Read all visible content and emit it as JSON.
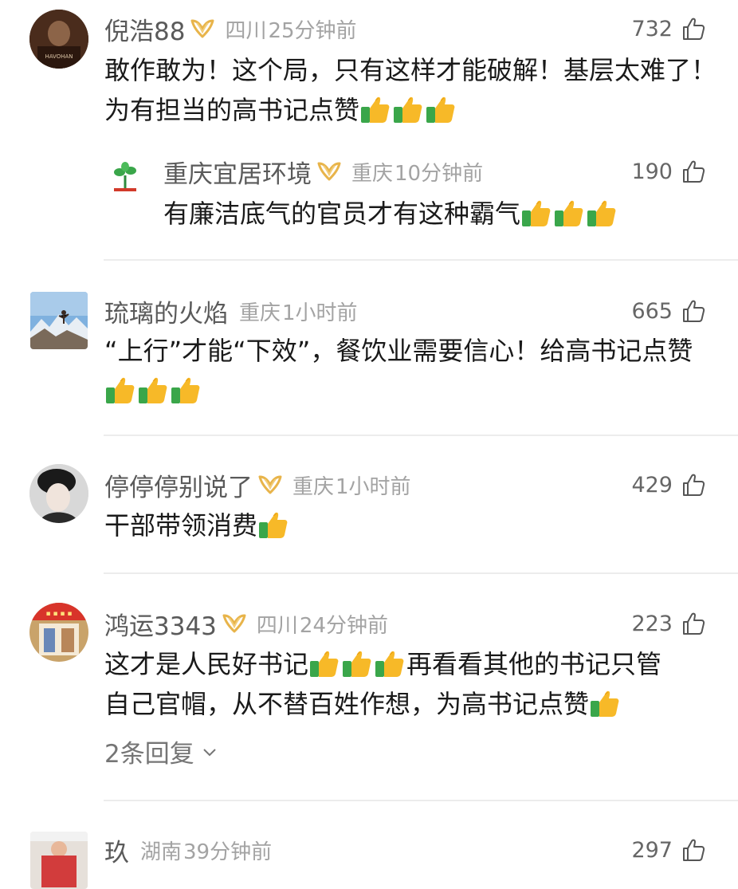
{
  "comments": [
    {
      "user": "倪浩88",
      "location": "四川",
      "time": "25分钟前",
      "likes": "732",
      "text": "敢作敢为！这个局，只有这样才能破解！基层太难了！为有担当的高书记点赞",
      "emoji_count": 3,
      "avatar_text": "HAVOHAN",
      "vip": true
    },
    {
      "user": "重庆宜居环境",
      "location": "重庆",
      "time": "10分钟前",
      "likes": "190",
      "text": "有廉洁底气的官员才有这种霸气",
      "emoji_count": 3,
      "vip": true
    },
    {
      "user": "琉璃的火焰",
      "location": "重庆",
      "time": "1小时前",
      "likes": "665",
      "text": "“上行”才能“下效”，餐饮业需要信心！给高书记点赞",
      "emoji_count": 3,
      "vip": false
    },
    {
      "user": "停停停别说了",
      "location": "重庆",
      "time": "1小时前",
      "likes": "429",
      "text": "干部带领消费",
      "emoji_count": 1,
      "vip": true
    },
    {
      "user": "鸿运3343",
      "location": "四川",
      "time": "24分钟前",
      "likes": "223",
      "text_part1": "这才是人民好书记",
      "text_part2": "再看看其他的书记只管",
      "text_line2": "自己官帽，从不替百姓作想，为高书记点赞",
      "replies": "2条回复",
      "vip": true
    },
    {
      "user": "玖",
      "location": "湖南",
      "time": "39分钟前",
      "likes": "297",
      "vip": false
    }
  ],
  "colors": {
    "vip_gold": "#e8b44a",
    "thumb_yellow": "#f7b928",
    "thumb_green": "#3aa64a"
  },
  "icons": [
    "thumbs-up-outline-icon",
    "thumbs-up-emoji",
    "vip-badge-icon",
    "chevron-down-icon"
  ]
}
